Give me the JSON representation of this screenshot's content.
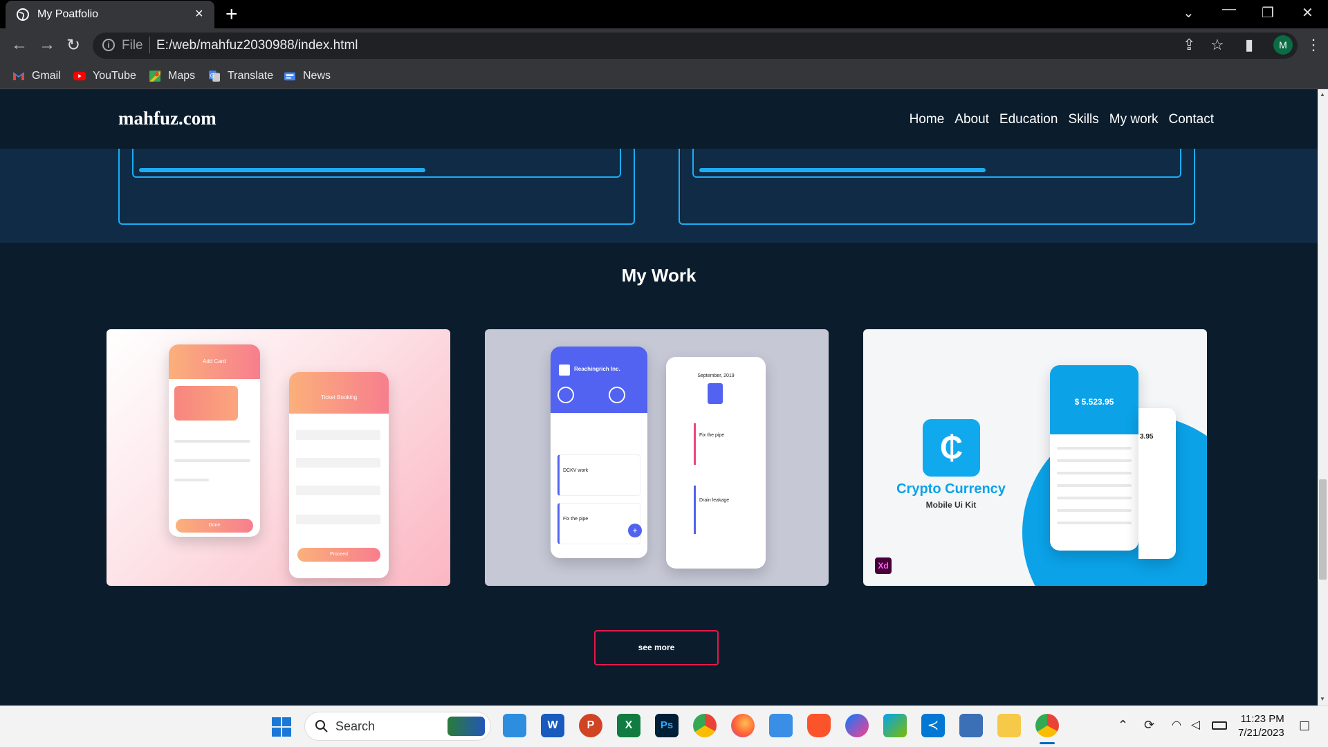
{
  "browser": {
    "tab_title": "My Poatfolio",
    "address_scheme": "File",
    "address_url": "E:/web/mahfuz2030988/index.html",
    "profile_initial": "M",
    "bookmarks": [
      "Gmail",
      "YouTube",
      "Maps",
      "Translate",
      "News"
    ]
  },
  "site": {
    "logo": "mahfuz.com",
    "nav": [
      "Home",
      "About",
      "Education",
      "Skills",
      "My work",
      "Contact"
    ],
    "section_title": "My Work",
    "see_more": "see more",
    "work_items": [
      {
        "screen1_title": "Add Card",
        "screen2_title": "Ticket Booking",
        "button1": "Done",
        "button2": "Proceed"
      },
      {
        "company": "Reachingrich Inc.",
        "month": "September, 2019",
        "task1": "DCKV work",
        "task2": "Fix the pipe",
        "task3": "Drain leakage"
      },
      {
        "title": "Crypto Currency",
        "subtitle": "Mobile Ui Kit",
        "balance": "$ 5.523.95",
        "badge": "Xd",
        "side_value": "3.95"
      }
    ]
  },
  "taskbar": {
    "search_label": "Search",
    "time": "11:23 PM",
    "date": "7/21/2023"
  },
  "colors": {
    "accent_blue": "#1dadf5",
    "accent_red": "#e5174a",
    "page_bg": "#0b1d2d",
    "band_bg": "#102b45"
  }
}
